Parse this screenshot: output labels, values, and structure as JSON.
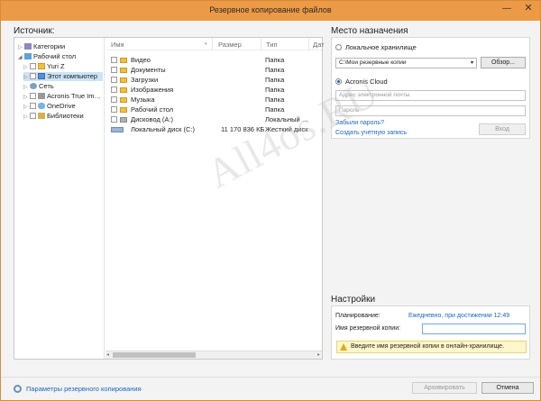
{
  "window": {
    "title": "Резервное копирование файлов",
    "minimize_glyph": "—",
    "close_glyph": "✕"
  },
  "source": {
    "label": "Источник:",
    "tree": [
      {
        "label": "Категории",
        "icon": "categories-icon",
        "has_check": false,
        "expander": "▷",
        "selected": false
      },
      {
        "label": "Рабочий стол",
        "icon": "desktop-icon",
        "has_check": false,
        "expander": "◢",
        "selected": false
      },
      {
        "label": "Yuri Z",
        "icon": "folder-icon",
        "has_check": true,
        "expander": "▷",
        "selected": false
      },
      {
        "label": "Этот компьютер",
        "icon": "computer-icon",
        "has_check": true,
        "expander": "▷",
        "selected": true
      },
      {
        "label": "Сеть",
        "icon": "network-icon",
        "has_check": false,
        "expander": "▷",
        "selected": false
      },
      {
        "label": "Acronis True Im…",
        "icon": "acronis-icon",
        "has_check": true,
        "expander": "▷",
        "selected": false
      },
      {
        "label": "OneDrive",
        "icon": "onedrive-icon",
        "has_check": true,
        "expander": "▷",
        "selected": false
      },
      {
        "label": "Библиотеки",
        "icon": "libraries-icon",
        "has_check": true,
        "expander": "▷",
        "selected": false
      }
    ],
    "columns": {
      "name": "Имя",
      "size": "Размер",
      "type": "Тип",
      "date": "Дат"
    },
    "files": [
      {
        "name": "Видео",
        "size": "",
        "type": "Папка",
        "icon": "folder-icon"
      },
      {
        "name": "Документы",
        "size": "",
        "type": "Папка",
        "icon": "folder-icon"
      },
      {
        "name": "Загрузки",
        "size": "",
        "type": "Папка",
        "icon": "folder-icon"
      },
      {
        "name": "Изображения",
        "size": "",
        "type": "Папка",
        "icon": "folder-icon"
      },
      {
        "name": "Музыка",
        "size": "",
        "type": "Папка",
        "icon": "folder-icon"
      },
      {
        "name": "Рабочий стол",
        "size": "",
        "type": "Папка",
        "icon": "folder-icon"
      },
      {
        "name": "Дисковод (A:)",
        "size": "",
        "type": "Локальный …",
        "icon": "floppy-drive-icon"
      },
      {
        "name": "Локальный диск (C:)",
        "size": "11 170 836 КБ",
        "type": "Жесткий диск",
        "icon": "hard-disk-icon"
      }
    ]
  },
  "destination": {
    "label": "Место назначения",
    "local_option": "Локальное хранилище",
    "local_path": "C:\\Мои резервные копии",
    "browse_button": "Обзор...",
    "cloud_option": "Acronis Cloud",
    "email_placeholder": "Адрес электронной почты",
    "password_placeholder": "Пароль",
    "forgot_password": "Забыли пароль?",
    "create_account": "Создать учетную запись",
    "login_button": "Вход",
    "selected": "cloud"
  },
  "settings": {
    "label": "Настройки",
    "schedule_key": "Планирование:",
    "schedule_value": "Ежедневно, при достижении 12:49",
    "backup_name_key": "Имя резервной копии:",
    "backup_name_value": "",
    "warning": "Введите имя резервной копии в онлайн-хранилище."
  },
  "footer": {
    "params_link": "Параметры резервного копирования",
    "archive_button": "Архивировать",
    "cancel_button": "Отмена"
  },
  "watermark": "All4os.RU",
  "colors": {
    "titlebar": "#ec9a45",
    "link": "#1e66c0",
    "warning_bg": "#fff6c9"
  }
}
